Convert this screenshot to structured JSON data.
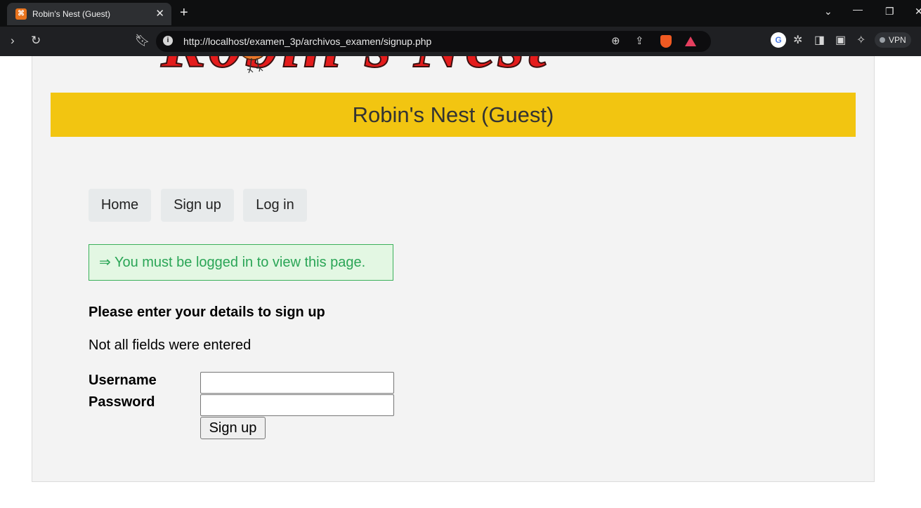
{
  "browser": {
    "tab_title": "Robin's Nest (Guest)",
    "tab_close": "✕",
    "new_tab": "+",
    "url": "http://localhost/examen_3p/archivos_examen/signup.php",
    "vpn_label": "VPN",
    "favicon_glyph": "⌘",
    "profile_glyph": "G"
  },
  "page": {
    "logo_text": "Robin's Nest",
    "banner_title": "Robin's Nest (Guest)",
    "menu": [
      {
        "label": "Home"
      },
      {
        "label": "Sign up"
      },
      {
        "label": "Log in"
      }
    ],
    "notice": "⇒ You must be logged in to view this page.",
    "form_heading": "Please enter your details to sign up",
    "error_message": "Not all fields were entered",
    "username_label": "Username",
    "password_label": "Password",
    "username_value": "",
    "password_value": "",
    "submit_label": "Sign up"
  },
  "colors": {
    "banner": "#f2c511",
    "logo_red": "#e41c1c",
    "notice_text": "#2aa556",
    "notice_bg": "#e3f7e3"
  }
}
